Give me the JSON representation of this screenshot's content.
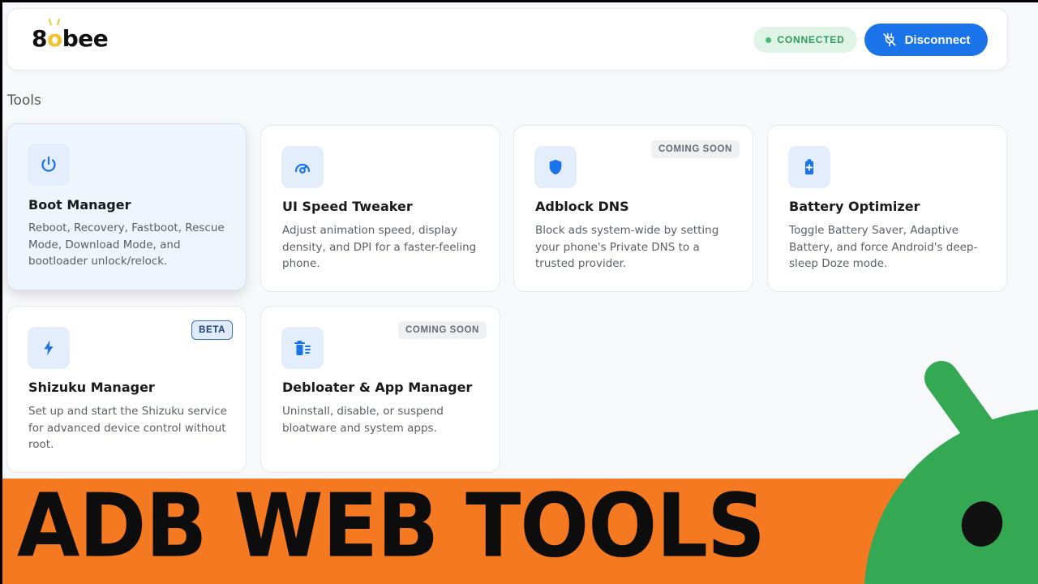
{
  "header": {
    "logo_prefix": "8",
    "logo_o": "o",
    "logo_suffix": "bee",
    "status": "CONNECTED",
    "disconnect_label": "Disconnect"
  },
  "section_title": "Tools",
  "tools": [
    {
      "title": "Boot Manager",
      "desc": "Reboot, Recovery, Fastboot, Rescue Mode, Download Mode, and bootloader unlock/relock.",
      "icon": "power-icon"
    },
    {
      "title": "UI Speed Tweaker",
      "desc": "Adjust animation speed, display density, and DPI for a faster-feeling phone.",
      "icon": "speedometer-icon"
    },
    {
      "title": "Adblock DNS",
      "desc": "Block ads system-wide by setting your phone's Private DNS to a trusted provider.",
      "icon": "shield-icon",
      "badge": "COMING SOON"
    },
    {
      "title": "Battery Optimizer",
      "desc": "Toggle Battery Saver, Adaptive Battery, and force Android's deep-sleep Doze mode.",
      "icon": "battery-icon"
    },
    {
      "title": "Shizuku Manager",
      "desc": "Set up and start the Shizuku service for advanced device control without root.",
      "icon": "bolt-icon",
      "badge": "BETA"
    },
    {
      "title": "Debloater & App Manager",
      "desc": "Uninstall, disable, or suspend bloatware and system apps.",
      "icon": "trash-list-icon",
      "badge": "COMING SOON"
    }
  ],
  "banner": {
    "title": "ADB WEB TOOLS"
  },
  "colors": {
    "accent": "#1a73e8",
    "banner": "#f47920",
    "android": "#34a853",
    "connected": "#2e9c5b"
  }
}
